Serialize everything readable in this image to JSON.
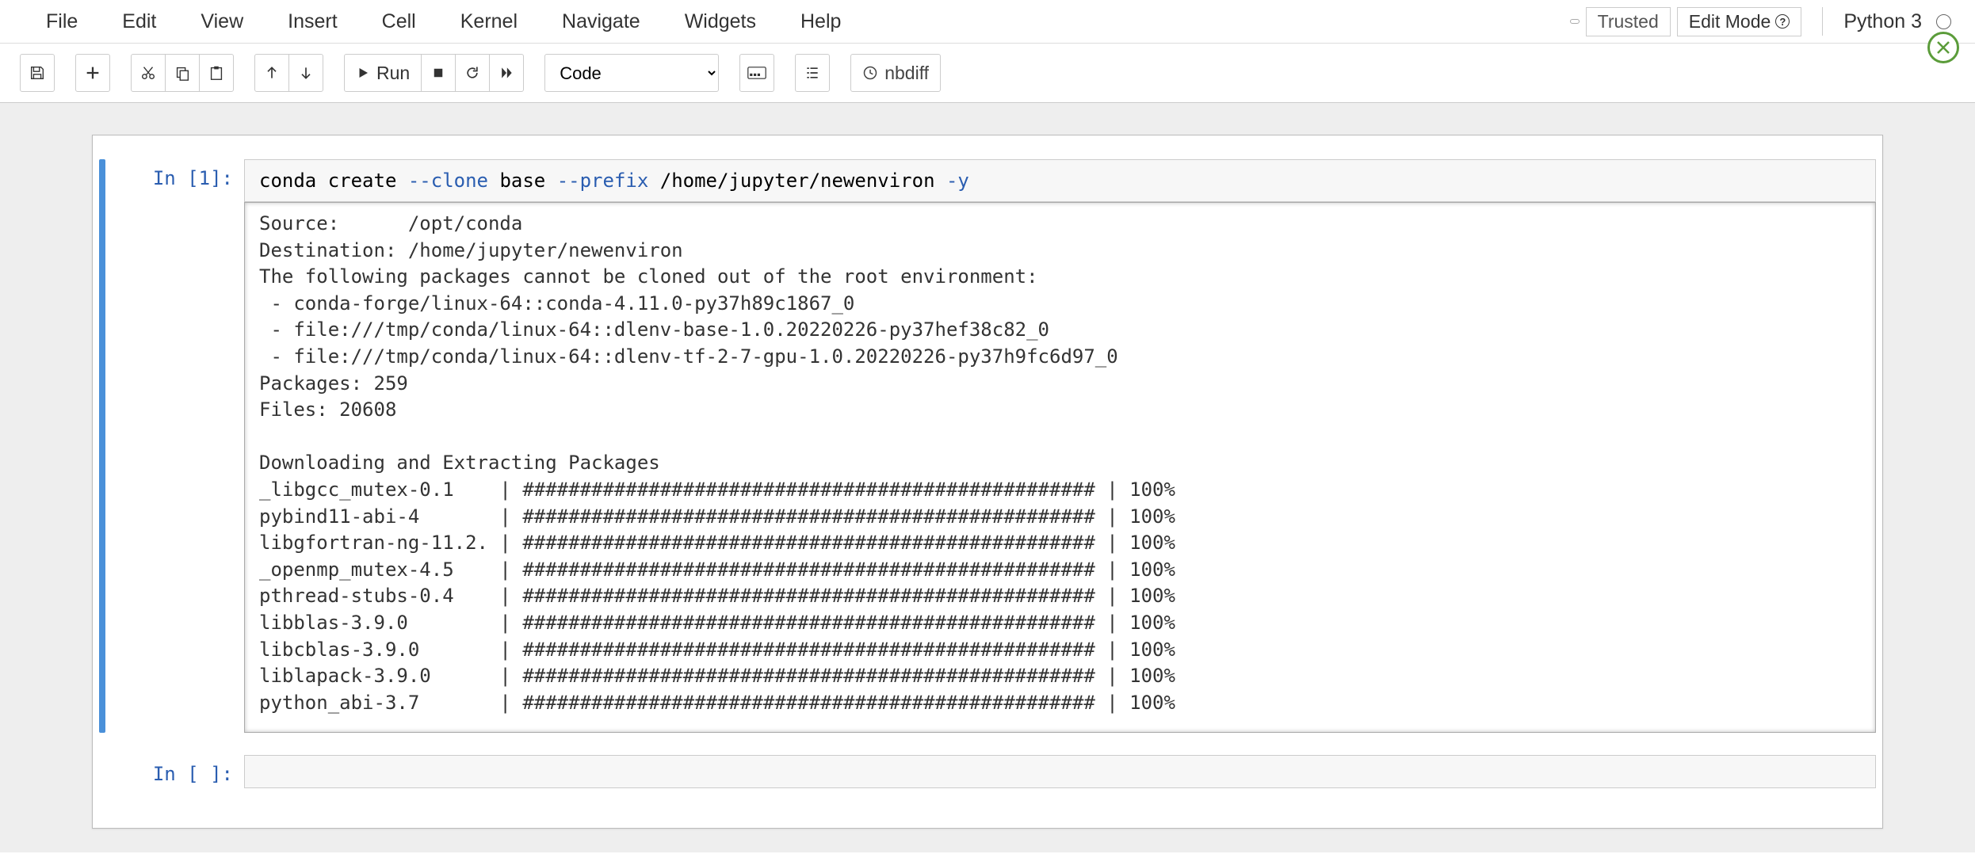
{
  "menu": {
    "items": [
      "File",
      "Edit",
      "View",
      "Insert",
      "Cell",
      "Kernel",
      "Navigate",
      "Widgets",
      "Help"
    ]
  },
  "status": {
    "trusted": "Trusted",
    "edit_mode": "Edit Mode",
    "kernel_name": "Python 3"
  },
  "toolbar": {
    "run_label": "Run",
    "cell_type": "Code",
    "nbdiff_label": "nbdiff"
  },
  "cells": [
    {
      "prompt": "In [1]:",
      "code_prefix": "conda create ",
      "code_flag1": "--clone",
      "code_mid1": " base ",
      "code_flag2": "--prefix",
      "code_mid2": " /home/jupyter/newenviron ",
      "code_flag3": "-y",
      "output": "Source:      /opt/conda\nDestination: /home/jupyter/newenviron\nThe following packages cannot be cloned out of the root environment:\n - conda-forge/linux-64::conda-4.11.0-py37h89c1867_0\n - file:///tmp/conda/linux-64::dlenv-base-1.0.20220226-py37hef38c82_0\n - file:///tmp/conda/linux-64::dlenv-tf-2-7-gpu-1.0.20220226-py37h9fc6d97_0\nPackages: 259\nFiles: 20608\n\nDownloading and Extracting Packages\n_libgcc_mutex-0.1    | ################################################## | 100%\npybind11-abi-4       | ################################################## | 100%\nlibgfortran-ng-11.2. | ################################################## | 100%\n_openmp_mutex-4.5    | ################################################## | 100%\npthread-stubs-0.4    | ################################################## | 100%\nlibblas-3.9.0        | ################################################## | 100%\nlibcblas-3.9.0       | ################################################## | 100%\nliblapack-3.9.0      | ################################################## | 100%\npython_abi-3.7       | ################################################## | 100%"
    },
    {
      "prompt": "In [ ]:",
      "code": ""
    }
  ]
}
